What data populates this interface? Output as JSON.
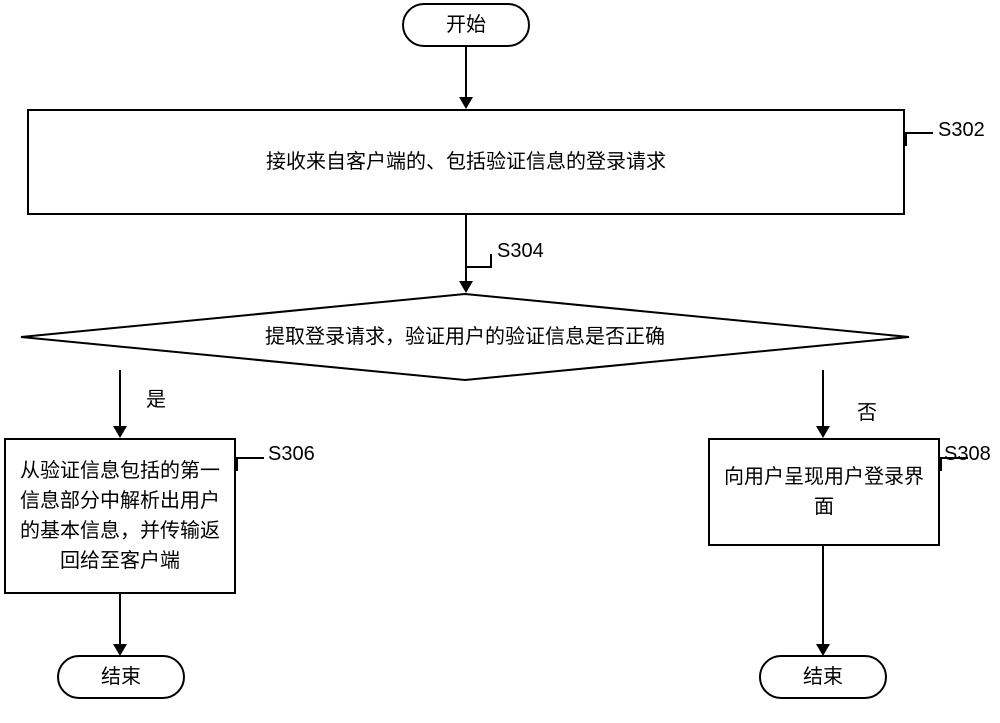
{
  "nodes": {
    "start": "开始",
    "s302_label": "S302",
    "s302_text": "接收来自客户端的、包括验证信息的登录请求",
    "s304_label": "S304",
    "s304_text": "提取登录请求，验证用户的验证信息是否正确",
    "yes_label": "是",
    "no_label": "否",
    "s306_label": "S306",
    "s306_text": "从验证信息包括的第一信息部分中解析出用户的基本信息，并传输返回给至客户端",
    "s308_label": "S308",
    "s308_text": "向用户呈现用户登录界面",
    "end": "结束"
  }
}
